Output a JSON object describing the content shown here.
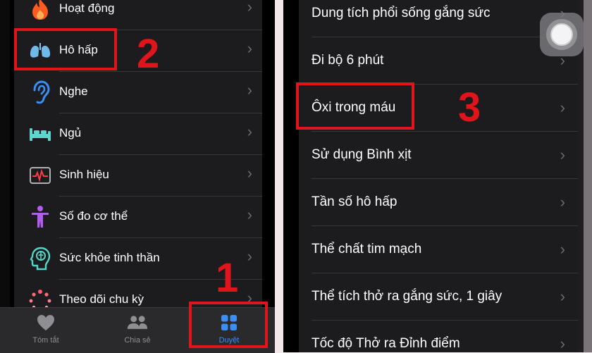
{
  "left_screen": {
    "categories": [
      {
        "label": "Hoạt động",
        "icon": "flame-icon"
      },
      {
        "label": "Hô hấp",
        "icon": "lungs-icon"
      },
      {
        "label": "Nghe",
        "icon": "ear-icon"
      },
      {
        "label": "Ngủ",
        "icon": "bed-icon"
      },
      {
        "label": "Sinh hiệu",
        "icon": "vitals-icon"
      },
      {
        "label": "Số đo cơ thể",
        "icon": "person-figure-icon"
      },
      {
        "label": "Sức khỏe tinh thần",
        "icon": "head-brain-icon"
      },
      {
        "label": "Theo dõi chu kỳ",
        "icon": "cycle-tracking-icon"
      }
    ],
    "tabbar": {
      "summary": "Tóm tắt",
      "sharing": "Chia sẻ",
      "browse": "Duyệt"
    }
  },
  "right_screen": {
    "items": [
      "Dung tích phổi sống gắng sức",
      "Đi bộ 6 phút",
      "Ôxi trong máu",
      "Sử dụng Bình xịt",
      "Tần số hô hấp",
      "Thể chất tim mạch",
      "Thể tích thở ra gắng sức, 1 giây",
      "Tốc độ Thở ra Đỉnh điểm"
    ]
  },
  "annotations": {
    "step1": "1",
    "step2": "2",
    "step3": "3",
    "color": "#e0141b"
  },
  "chevron": "›",
  "colors": {
    "list_bg": "#1c1c1e",
    "accent_blue": "#3a8ef6",
    "annotation_red": "#e0141b"
  }
}
